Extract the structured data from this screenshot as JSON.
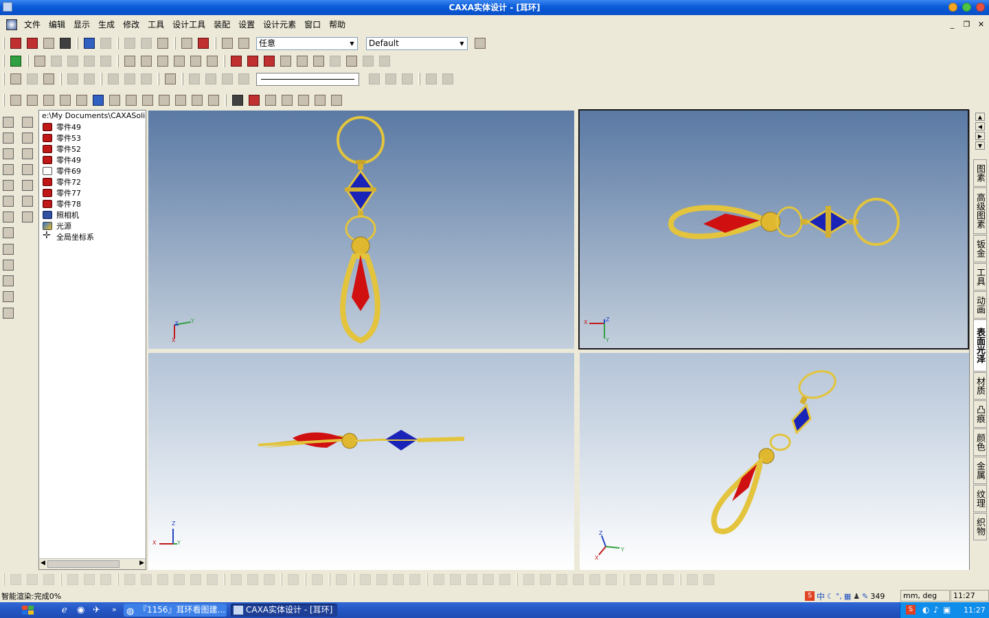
{
  "window": {
    "title": "CAXA实体设计 - [耳环]"
  },
  "menu": [
    "文件",
    "编辑",
    "显示",
    "生成",
    "修改",
    "工具",
    "设计工具",
    "装配",
    "设置",
    "设计元素",
    "窗口",
    "帮助"
  ],
  "toolbar": {
    "filter_value": "任意",
    "style_value": "Default"
  },
  "tree": {
    "path": "e:\\My Documents\\CAXASolid\\E",
    "items": [
      {
        "label": "零件49",
        "icon": "part-icon"
      },
      {
        "label": "零件53",
        "icon": "part-icon"
      },
      {
        "label": "零件52",
        "icon": "part-icon"
      },
      {
        "label": "零件49",
        "icon": "part-icon"
      },
      {
        "label": "零件69",
        "icon": "part-outline-icon"
      },
      {
        "label": "零件72",
        "icon": "part-icon"
      },
      {
        "label": "零件77",
        "icon": "part-icon"
      },
      {
        "label": "零件78",
        "icon": "part-icon"
      },
      {
        "label": "照相机",
        "icon": "camera-icon"
      },
      {
        "label": "光源",
        "icon": "light-icon"
      },
      {
        "label": "全局坐标系",
        "icon": "axes-icon"
      }
    ]
  },
  "viewports": {
    "tl": {
      "axes": {
        "x": "X",
        "y": "Y",
        "z": "Z"
      }
    },
    "tr": {
      "axes": {
        "x": "X",
        "y": "Y",
        "z": "Z"
      }
    },
    "bl": {
      "axes": {
        "x": "X",
        "y": "Y",
        "z": "Z"
      }
    },
    "br": {
      "axes": {
        "x": "X",
        "y": "Y",
        "z": "Z"
      }
    }
  },
  "right_tabs": [
    "图素",
    "高级图素",
    "钣金",
    "工具",
    "动画",
    "表面光泽",
    "材质",
    "凸痕",
    "颜色",
    "金属",
    "纹理",
    "织物"
  ],
  "right_tab_selected": "表面光泽",
  "status": {
    "message": "智能渲染:完成0%",
    "count": "349",
    "units": "mm, deg",
    "time": "11:27"
  },
  "taskbar": {
    "tasks": [
      "『1156』耳环看图建...",
      "CAXA实体设计 - [耳环]"
    ],
    "clock": "11:27"
  },
  "colors": {
    "gold": "#e3c43c",
    "ruby": "#d01010",
    "sapphire": "#1a23b8"
  }
}
